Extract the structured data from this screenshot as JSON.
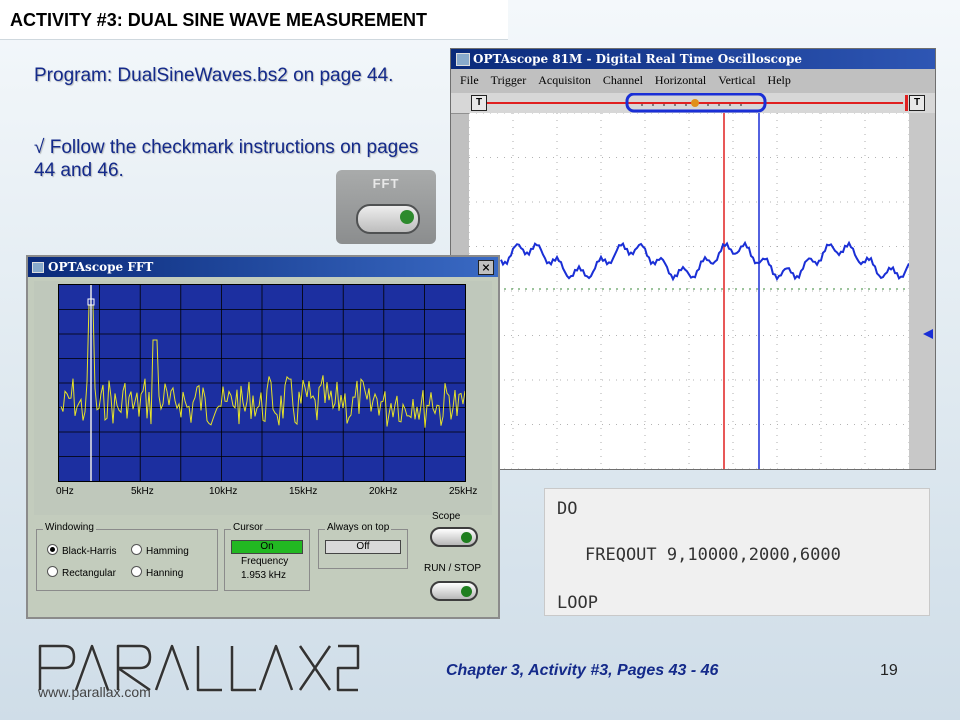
{
  "slide": {
    "title": "ACTIVITY #3: DUAL SINE WAVE MEASUREMENT",
    "program_line": "Program: DualSineWaves.bs2 on page 44.",
    "checkmark_line": "√ Follow the checkmark instructions on pages 44 and 46.",
    "footer_chapter": "Chapter 3, Activity #3, Pages 43 - 46",
    "page_number": "19",
    "logo_url": "www.parallax.com"
  },
  "fft_button": {
    "label": "FFT"
  },
  "scope_window": {
    "title": "OPTAscope 81M - Digital Real Time Oscilloscope",
    "menu": [
      "File",
      "Trigger",
      "Acquisiton",
      "Channel",
      "Horizontal",
      "Vertical",
      "Help"
    ],
    "trigger_marker_left": "T",
    "trigger_marker_right": "T",
    "accent_trace": "#1a2fd6",
    "cursor_red": "#e02020",
    "cursor_blue": "#1a2fd6"
  },
  "fft_window": {
    "title": "OPTAscope FFT",
    "close_label": "×",
    "x_ticks": [
      "0Hz",
      "5kHz",
      "10kHz",
      "15kHz",
      "20kHz",
      "25kHz"
    ],
    "windowing": {
      "label": "Windowing",
      "options": [
        "Black-Harris",
        "Hamming",
        "Rectangular",
        "Hanning"
      ],
      "selected": "Black-Harris"
    },
    "cursor": {
      "label": "Cursor",
      "state": "On",
      "frequency_label": "Frequency",
      "frequency_value": "1.953 kHz"
    },
    "always_on_top": {
      "label": "Always on top",
      "state": "Off"
    },
    "scope_label": "Scope",
    "run_stop_label": "RUN / STOP"
  },
  "code": {
    "line1": "DO",
    "line2": "FREQOUT 9,10000,2000,6000",
    "line3": "LOOP"
  }
}
